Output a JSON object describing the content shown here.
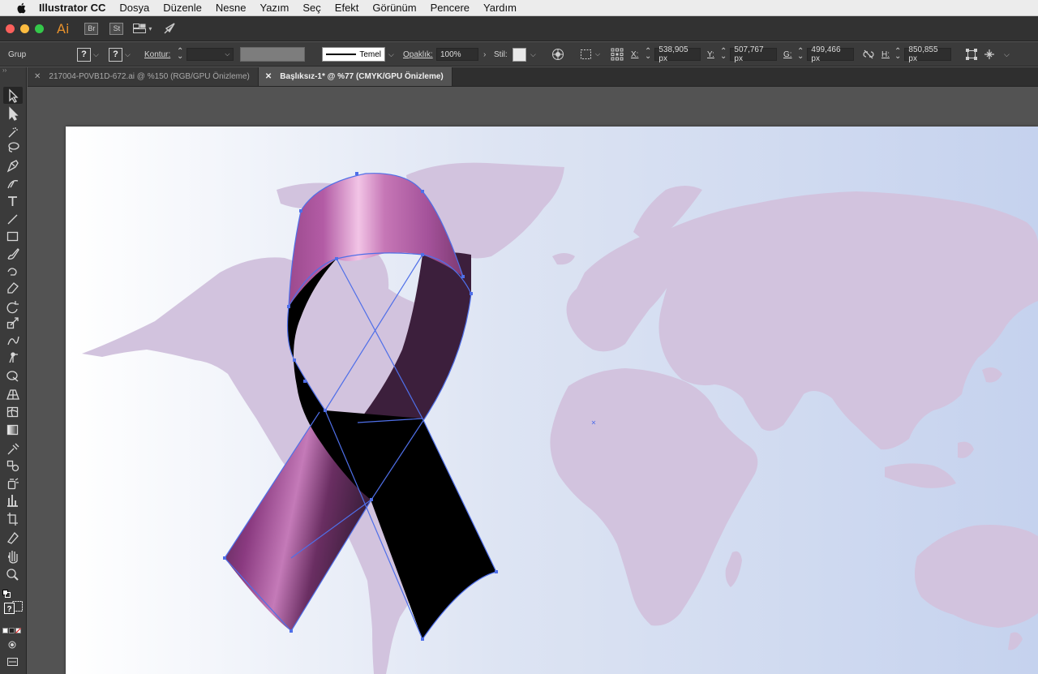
{
  "menubar": {
    "app_name": "Illustrator CC",
    "items": [
      "Dosya",
      "Düzenle",
      "Nesne",
      "Yazım",
      "Seç",
      "Efekt",
      "Görünüm",
      "Pencere",
      "Yardım"
    ]
  },
  "appbar": {
    "logo": "Ai",
    "bridge_label": "Br",
    "stock_label": "St"
  },
  "control": {
    "selection_type": "Grup",
    "fill_swatch": "?",
    "stroke_swatch": "?",
    "stroke_label": "Kontur:",
    "brush_name": "Temel",
    "opacity_label": "Opaklık:",
    "opacity_value": "100%",
    "style_label": "Stil:",
    "x_label": "X:",
    "x_value": "538,905 px",
    "y_label": "Y:",
    "y_value": "507,767 px",
    "w_label": "G:",
    "w_value": "499,466 px",
    "h_label": "H:",
    "h_value": "850,855 px"
  },
  "tabs": [
    {
      "label": "217004-P0VB1D-672.ai @ %150 (RGB/GPU Önizleme)",
      "active": false
    },
    {
      "label": "Başlıksız-1* @ %77 (CMYK/GPU Önizleme)",
      "active": true
    }
  ],
  "colors": {
    "ribbon_pink": "#b058a0",
    "ribbon_highlight": "#f2c4e6",
    "ribbon_dark": "#3c1f3c",
    "ribbon_black": "#000000",
    "selection_blue": "#4f6fe8",
    "map_color": "#d2c3de",
    "artboard_left": "#ffffff",
    "artboard_right": "#c5d2ee"
  },
  "icons": {
    "tools": [
      "selection-tool-icon",
      "direct-selection-tool-icon",
      "magic-wand-icon",
      "lasso-icon",
      "pen-tool-icon",
      "curvature-tool-icon",
      "type-tool-icon",
      "line-tool-icon",
      "rectangle-tool-icon",
      "paintbrush-icon",
      "shaper-tool-icon",
      "eraser-icon",
      "rotate-tool-icon",
      "scale-tool-icon",
      "warp-tool-icon",
      "puppet-warp-icon",
      "shape-builder-icon",
      "perspective-grid-icon",
      "mesh-tool-icon",
      "gradient-tool-icon",
      "eyedropper-icon",
      "blend-tool-icon",
      "symbol-sprayer-icon",
      "graph-tool-icon",
      "artboard-tool-icon",
      "slice-tool-icon",
      "hand-tool-icon",
      "zoom-tool-icon"
    ]
  }
}
